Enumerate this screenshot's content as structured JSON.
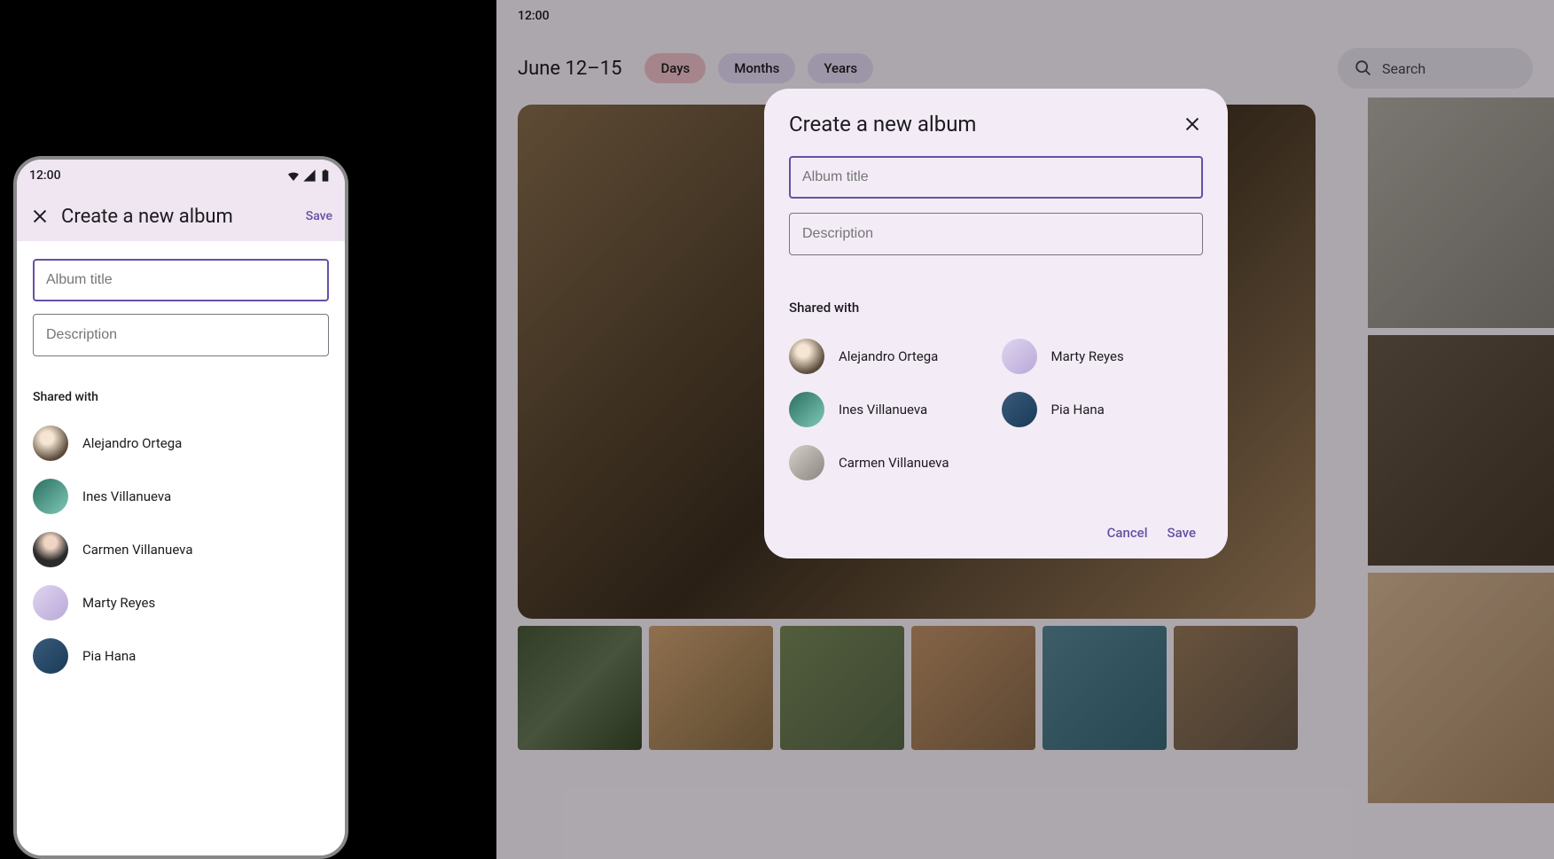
{
  "statusbar_time": "12:00",
  "phone": {
    "appbar_title": "Create a new album",
    "save_label": "Save",
    "album_title_placeholder": "Album title",
    "description_placeholder": "Description",
    "shared_with_label": "Shared with",
    "people": [
      {
        "name": "Alejandro Ortega",
        "avatar": "av-1"
      },
      {
        "name": "Ines Villanueva",
        "avatar": "av-2"
      },
      {
        "name": "Carmen Villanueva",
        "avatar": "av-3"
      },
      {
        "name": "Marty Reyes",
        "avatar": "av-4"
      },
      {
        "name": "Pia Hana",
        "avatar": "av-5"
      }
    ]
  },
  "tablet": {
    "date_range": "June 12–15",
    "chips": {
      "days": "Days",
      "months": "Months",
      "years": "Years"
    },
    "search_placeholder": "Search",
    "dialog": {
      "title": "Create a new album",
      "album_title_placeholder": "Album title",
      "description_placeholder": "Description",
      "shared_with_label": "Shared with",
      "people": [
        {
          "name": "Alejandro Ortega",
          "avatar": "av-1"
        },
        {
          "name": "Marty Reyes",
          "avatar": "av-4"
        },
        {
          "name": "Ines Villanueva",
          "avatar": "av-2"
        },
        {
          "name": "Pia Hana",
          "avatar": "av-5"
        },
        {
          "name": "Carmen Villanueva",
          "avatar": "av-6"
        }
      ],
      "cancel_label": "Cancel",
      "save_label": "Save"
    }
  }
}
